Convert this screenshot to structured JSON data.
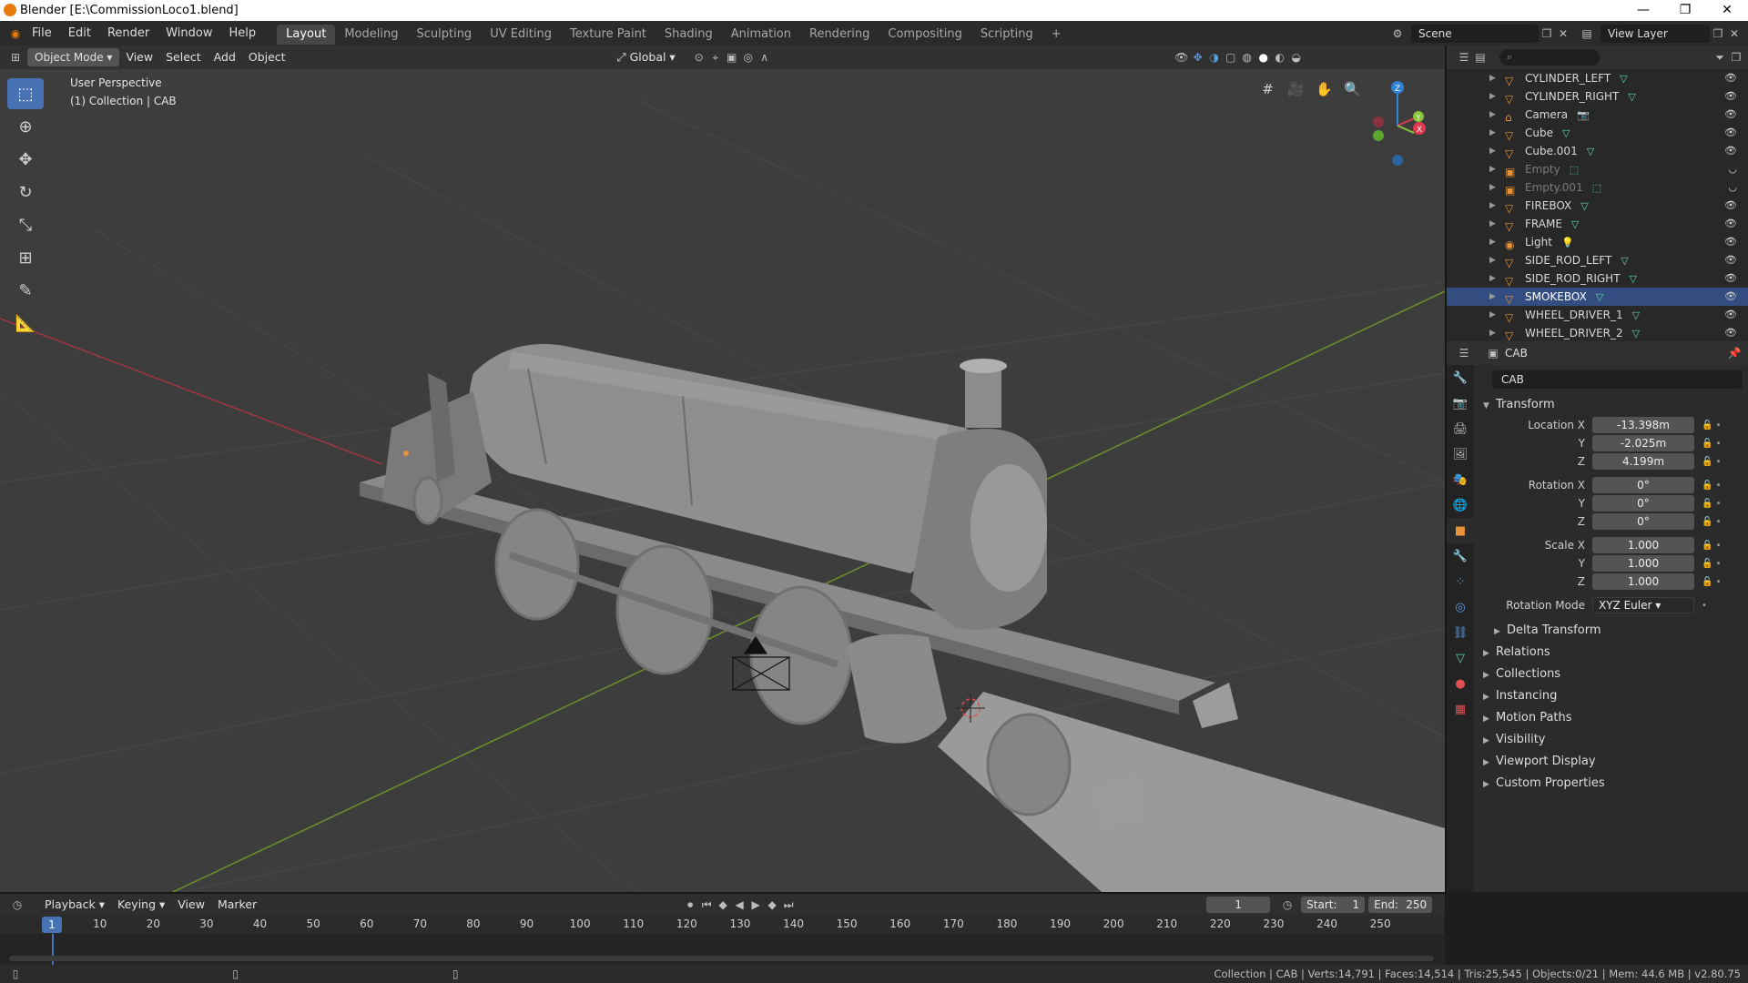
{
  "window": {
    "title": "Blender [E:\\CommissionLoco1.blend]",
    "minimize": "—",
    "maximize": "❐",
    "close": "✕"
  },
  "menu": [
    "File",
    "Edit",
    "Render",
    "Window",
    "Help"
  ],
  "workspaces": [
    "Layout",
    "Modeling",
    "Sculpting",
    "UV Editing",
    "Texture Paint",
    "Shading",
    "Animation",
    "Rendering",
    "Compositing",
    "Scripting"
  ],
  "active_workspace": "Layout",
  "add_workspace": "+",
  "scene": "Scene",
  "view_layer": "View Layer",
  "viewport": {
    "mode": "Object Mode",
    "menus": [
      "View",
      "Select",
      "Add",
      "Object"
    ],
    "orientation": "Global",
    "perspective_label": "User Perspective",
    "collection_label": "(1) Collection | CAB",
    "gizmo": {
      "x": "X",
      "y": "Y",
      "z": "Z"
    }
  },
  "outliner": {
    "search_placeholder": "",
    "items": [
      {
        "name": "CYLINDER_LEFT",
        "dim": false,
        "selected": false,
        "icon": "mesh"
      },
      {
        "name": "CYLINDER_RIGHT",
        "dim": false,
        "selected": false,
        "icon": "mesh"
      },
      {
        "name": "Camera",
        "dim": false,
        "selected": false,
        "icon": "camera"
      },
      {
        "name": "Cube",
        "dim": false,
        "selected": false,
        "icon": "mesh"
      },
      {
        "name": "Cube.001",
        "dim": false,
        "selected": false,
        "icon": "mesh"
      },
      {
        "name": "Empty",
        "dim": true,
        "selected": false,
        "icon": "empty"
      },
      {
        "name": "Empty.001",
        "dim": true,
        "selected": false,
        "icon": "empty"
      },
      {
        "name": "FIREBOX",
        "dim": false,
        "selected": false,
        "icon": "mesh"
      },
      {
        "name": "FRAME",
        "dim": false,
        "selected": false,
        "icon": "mesh"
      },
      {
        "name": "Light",
        "dim": false,
        "selected": false,
        "icon": "light"
      },
      {
        "name": "SIDE_ROD_LEFT",
        "dim": false,
        "selected": false,
        "icon": "mesh"
      },
      {
        "name": "SIDE_ROD_RIGHT",
        "dim": false,
        "selected": false,
        "icon": "mesh"
      },
      {
        "name": "SMOKEBOX",
        "dim": false,
        "selected": true,
        "icon": "mesh"
      },
      {
        "name": "WHEEL_DRIVER_1",
        "dim": false,
        "selected": false,
        "icon": "mesh"
      },
      {
        "name": "WHEEL_DRIVER_2",
        "dim": false,
        "selected": false,
        "icon": "mesh"
      }
    ]
  },
  "properties": {
    "context": "CAB",
    "object_name": "CAB",
    "transform_title": "Transform",
    "location": {
      "label": "Location X",
      "x": "-13.398m",
      "y": "-2.025m",
      "z": "4.199m"
    },
    "rotation": {
      "label": "Rotation X",
      "x": "0°",
      "y": "0°",
      "z": "0°"
    },
    "scale": {
      "label": "Scale X",
      "x": "1.000",
      "y": "1.000",
      "z": "1.000"
    },
    "axis_y": "Y",
    "axis_z": "Z",
    "rotation_mode_label": "Rotation Mode",
    "rotation_mode": "XYZ Euler",
    "delta_transform": "Delta Transform",
    "panels": [
      "Relations",
      "Collections",
      "Instancing",
      "Motion Paths",
      "Visibility",
      "Viewport Display",
      "Custom Properties"
    ]
  },
  "timeline": {
    "menus": [
      "Playback",
      "Keying",
      "View",
      "Marker"
    ],
    "current_frame": "1",
    "start_label": "Start:",
    "start": "1",
    "end_label": "End:",
    "end": "250",
    "ticks": [
      "10",
      "20",
      "30",
      "40",
      "50",
      "60",
      "70",
      "80",
      "90",
      "100",
      "110",
      "120",
      "130",
      "140",
      "150",
      "160",
      "170",
      "180",
      "190",
      "200",
      "210",
      "220",
      "230",
      "240",
      "250"
    ]
  },
  "statusbar": {
    "stats": "Collection | CAB | Verts:14,791 | Faces:14,514 | Tris:25,545 | Objects:0/21 | Mem: 44.6 MB | v2.80.75"
  },
  "colors": {
    "accent": "#4772b3",
    "selection": "#334d80",
    "viewport_bg": "#3d3d3d",
    "axis_x": "#e0384f",
    "axis_y": "#8ac43a",
    "axis_z": "#2e82d4",
    "object_orange": "#e8933a",
    "mesh_green": "#5fd6a8"
  }
}
